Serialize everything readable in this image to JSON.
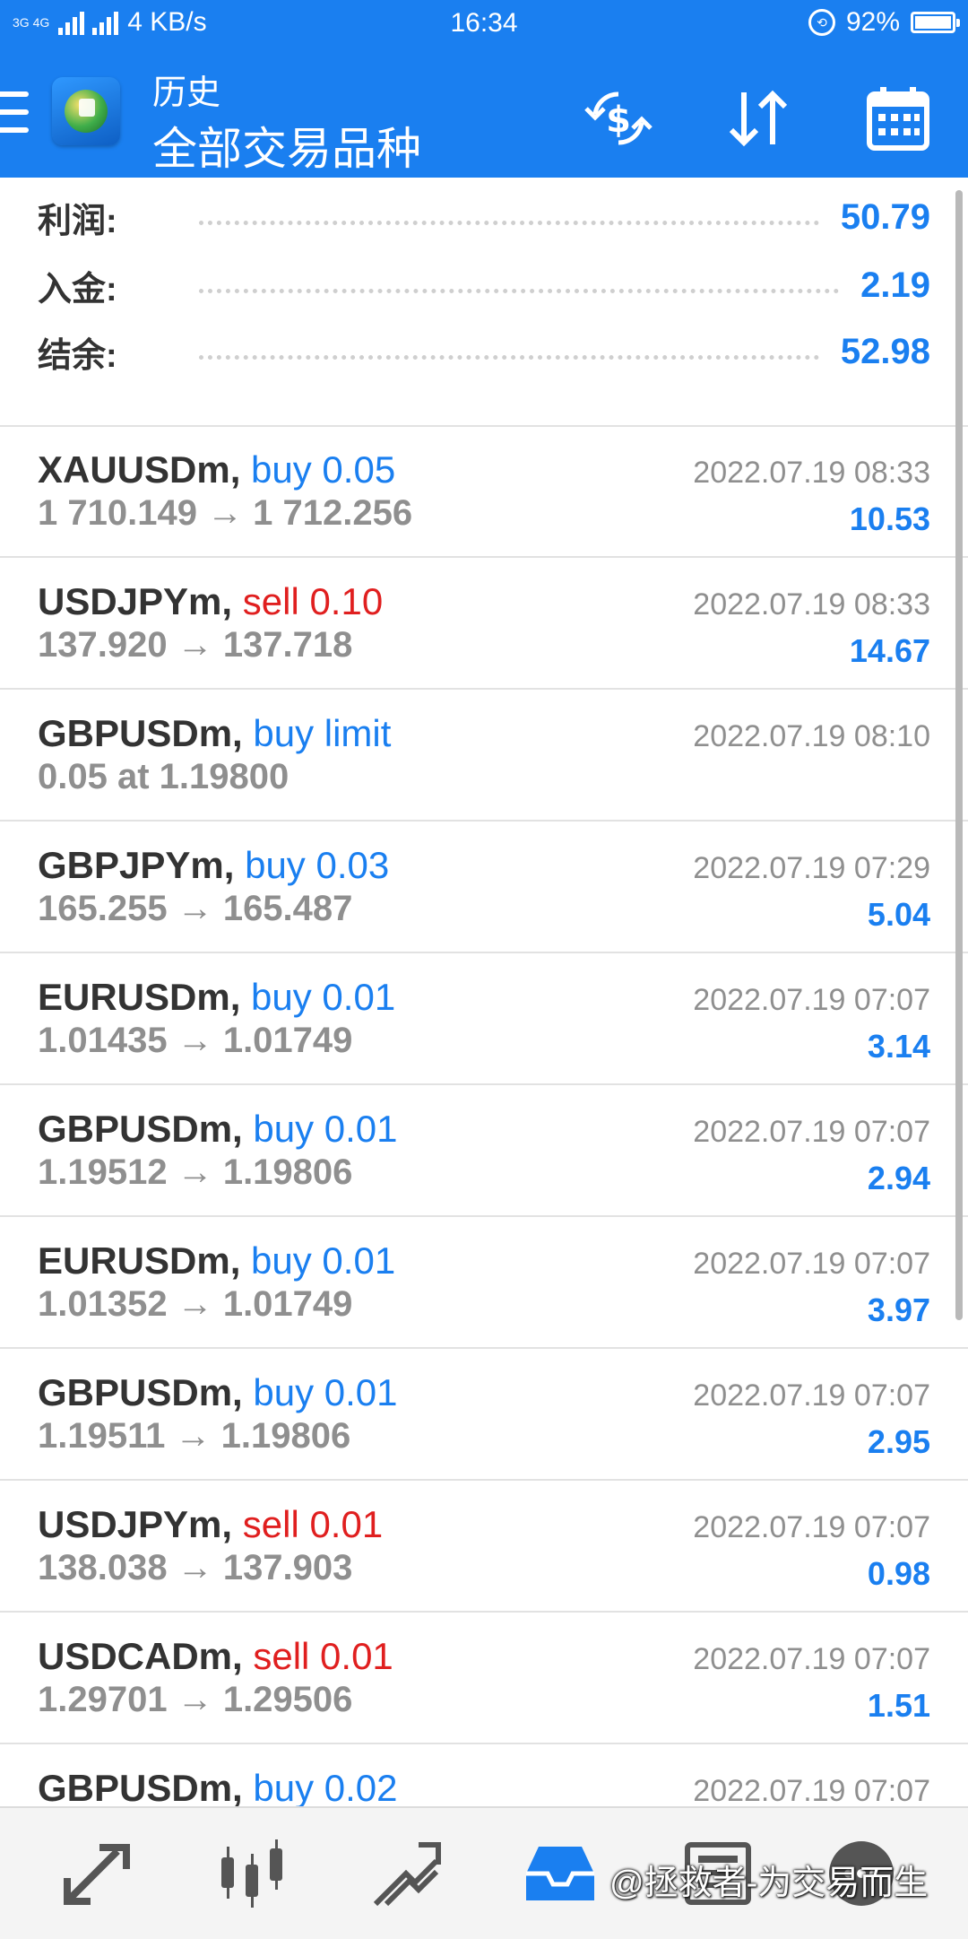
{
  "status_bar": {
    "network": "3G 4G",
    "speed": "4 KB/s",
    "time": "16:34",
    "battery": "92%",
    "battery_level": 0.92
  },
  "app_bar": {
    "title": "历史",
    "subtitle": "全部交易品种",
    "icons": [
      "exchange-dollar-icon",
      "sort-icon",
      "calendar-icon"
    ]
  },
  "summary": {
    "rows": [
      {
        "label": "利润:",
        "value": "50.79"
      },
      {
        "label": "入金:",
        "value": "2.19"
      },
      {
        "label": "结余:",
        "value": "52.98"
      }
    ]
  },
  "deals": [
    {
      "symbol": "XAUUSDm,",
      "action": "buy 0.05",
      "side": "buy",
      "prices": "1 710.149 → 1 712.256",
      "time": "2022.07.19 08:33",
      "profit": "10.53"
    },
    {
      "symbol": "USDJPYm,",
      "action": "sell 0.10",
      "side": "sell",
      "prices": "137.920 → 137.718",
      "time": "2022.07.19 08:33",
      "profit": "14.67"
    },
    {
      "symbol": "GBPUSDm,",
      "action": "buy limit",
      "side": "buy",
      "prices": "0.05 at 1.19800",
      "time": "2022.07.19 08:10",
      "profit": ""
    },
    {
      "symbol": "GBPJPYm,",
      "action": "buy 0.03",
      "side": "buy",
      "prices": "165.255 → 165.487",
      "time": "2022.07.19 07:29",
      "profit": "5.04"
    },
    {
      "symbol": "EURUSDm,",
      "action": "buy 0.01",
      "side": "buy",
      "prices": "1.01435 → 1.01749",
      "time": "2022.07.19 07:07",
      "profit": "3.14"
    },
    {
      "symbol": "GBPUSDm,",
      "action": "buy 0.01",
      "side": "buy",
      "prices": "1.19512 → 1.19806",
      "time": "2022.07.19 07:07",
      "profit": "2.94"
    },
    {
      "symbol": "EURUSDm,",
      "action": "buy 0.01",
      "side": "buy",
      "prices": "1.01352 → 1.01749",
      "time": "2022.07.19 07:07",
      "profit": "3.97"
    },
    {
      "symbol": "GBPUSDm,",
      "action": "buy 0.01",
      "side": "buy",
      "prices": "1.19511 → 1.19806",
      "time": "2022.07.19 07:07",
      "profit": "2.95"
    },
    {
      "symbol": "USDJPYm,",
      "action": "sell 0.01",
      "side": "sell",
      "prices": "138.038 → 137.903",
      "time": "2022.07.19 07:07",
      "profit": "0.98"
    },
    {
      "symbol": "USDCADm,",
      "action": "sell 0.01",
      "side": "sell",
      "prices": "1.29701 → 1.29506",
      "time": "2022.07.19 07:07",
      "profit": "1.51"
    },
    {
      "symbol": "GBPUSDm,",
      "action": "buy 0.02",
      "side": "buy",
      "prices": "",
      "time": "2022.07.19 07:07",
      "profit": ""
    }
  ],
  "bottom_nav": {
    "items": [
      "quotes-icon",
      "chart-candles-icon",
      "trade-icon",
      "history-inbox-icon",
      "news-icon",
      "chat-icon"
    ],
    "active": "history-inbox-icon"
  },
  "watermark": "@拯救者-为交易而生",
  "colors": {
    "primary": "#1a7ff0",
    "sell": "#e01f1f",
    "text_dark": "#333333",
    "text_grey": "#8f8f8f"
  }
}
